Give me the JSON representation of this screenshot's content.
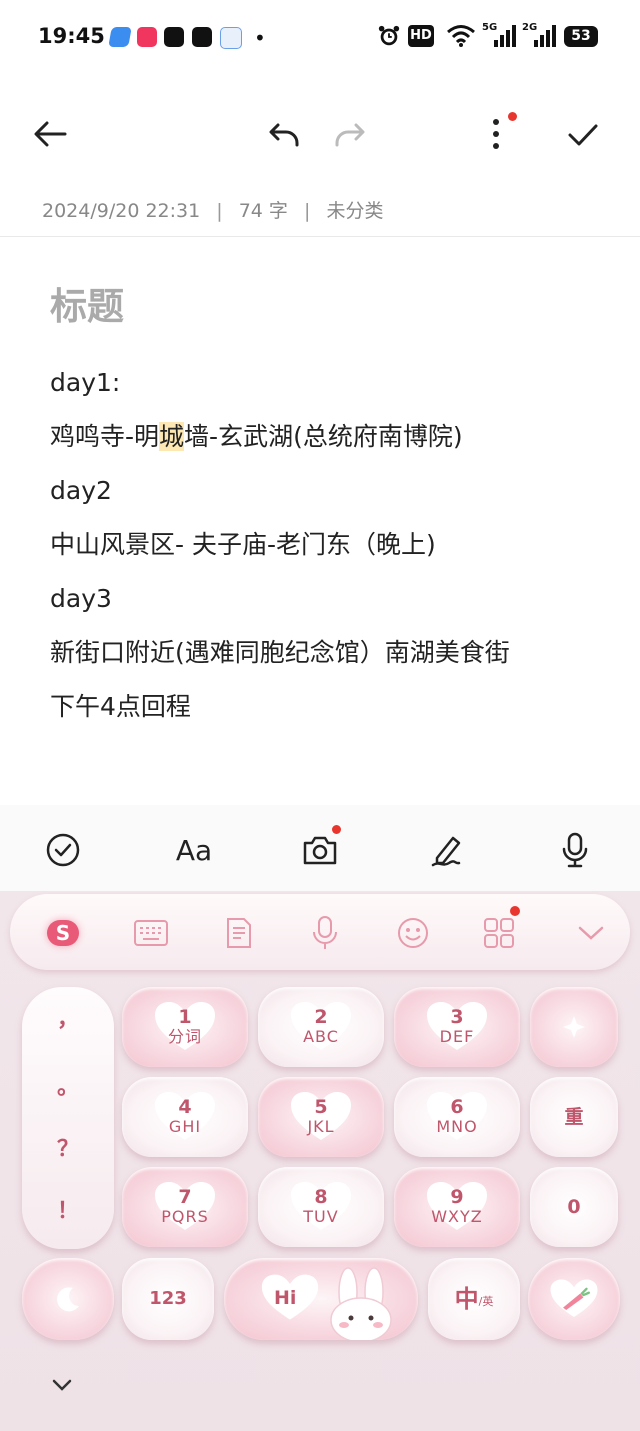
{
  "status_bar": {
    "time": "19:45",
    "battery": "53",
    "network_1": "5G",
    "network_2": "2G",
    "hd": "HD"
  },
  "toolbar": {
    "back_icon": "arrow-left-icon",
    "undo_icon": "undo-icon",
    "redo_icon": "redo-icon",
    "more_icon": "more-vertical-icon",
    "done_icon": "check-icon"
  },
  "meta": {
    "datetime": "2024/9/20 22:31",
    "separator": "|",
    "word_count": "74 字",
    "category": "未分类"
  },
  "note": {
    "title_placeholder": "标题",
    "lines": [
      {
        "text": "day1:"
      },
      {
        "pre": "鸡鸣寺-明",
        "highlight": "城",
        "post": "墙-玄武湖(总统府南博院)"
      },
      {
        "text": "day2"
      },
      {
        "text": "中山风景区- 夫子庙-老门东（晚上)"
      },
      {
        "text": "day3"
      },
      {
        "text": "新街口附近(遇难同胞纪念馆）南湖美食街"
      },
      {
        "text": "下午4点回程"
      }
    ]
  },
  "format_bar": {
    "font_label": "Aa",
    "items": [
      "checklist-icon",
      "font-icon",
      "camera-icon",
      "pen-icon",
      "microphone-icon"
    ]
  },
  "keyboard": {
    "top_row": [
      "sogou-logo-icon",
      "keyboard-icon",
      "clipboard-icon",
      "voice-icon",
      "emoji-icon",
      "apps-icon",
      "chevron-down-icon"
    ],
    "punctuation": [
      "，",
      "。",
      "？",
      "！"
    ],
    "keys": [
      {
        "digit": "1",
        "letters": "分词"
      },
      {
        "digit": "2",
        "letters": "ABC"
      },
      {
        "digit": "3",
        "letters": "DEF"
      },
      {
        "digit": "4",
        "letters": "GHI"
      },
      {
        "digit": "5",
        "letters": "JKL"
      },
      {
        "digit": "6",
        "letters": "MNO"
      },
      {
        "digit": "7",
        "letters": "PQRS"
      },
      {
        "digit": "8",
        "letters": "TUV"
      },
      {
        "digit": "9",
        "letters": "WXYZ"
      }
    ],
    "sparkle_icon": "sparkle-icon",
    "reset_label": "重",
    "zero_label": "0",
    "moon_icon": "moon-icon",
    "num_label": "123",
    "space_label": "Hi",
    "lang_label": "中",
    "lang_sub": "/英",
    "enter_icon": "carrot-heart-icon",
    "collapse_icon": "chevron-down-icon"
  },
  "colors": {
    "accent": "#c0566c",
    "highlight": "#fde7b3",
    "notification_dot": "#e8362e"
  }
}
